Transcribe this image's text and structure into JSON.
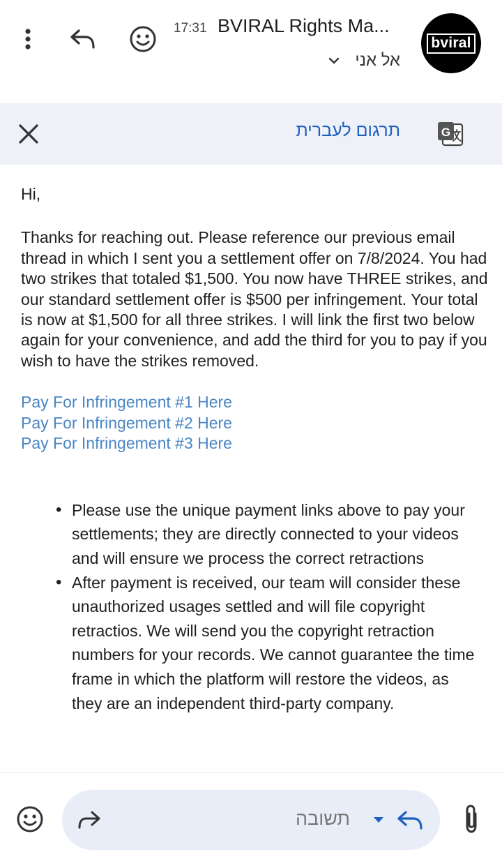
{
  "header": {
    "time": "17:31",
    "sender": "BVIRAL Rights Ma...",
    "recipient": "אל אני",
    "avatar_text": "bviral"
  },
  "translate_bar": {
    "label": "תרגום לעברית"
  },
  "email": {
    "greeting": "Hi,",
    "paragraph": "Thanks for reaching out. Please reference our previous email thread in which I sent you a settlement offer on 7/8/2024. You had two strikes that totaled $1,500. You now have THREE strikes, and our standard settlement offer is $500 per infringement. Your total is now at $1,500 for all three strikes. I will link the first two below again for your convenience, and add the third for you to pay if you wish to have the strikes removed.",
    "links": [
      "Pay For Infringement #1 Here",
      "Pay For Infringement #2 Here",
      "Pay For Infringement #3 Here"
    ],
    "bullets": [
      "Please use the unique payment links above to pay your settlements; they are directly connected to your videos and will ensure we process the correct retractions",
      "After payment is received, our team will consider these unauthorized usages settled and will file copyright retractios. We will send you the copyright retraction numbers for your records. We cannot guarantee the time frame in which the platform will restore the videos, as they are an independent third-party company."
    ]
  },
  "bottom_bar": {
    "reply_label": "תשובה"
  },
  "colors": {
    "link": "#4a86c4",
    "translate_link": "#1f5fbf",
    "translate_bg": "#eef1f8",
    "reply_pill_bg": "#e9edf8"
  },
  "icons": {
    "kebab": "more-vert-icon",
    "reply": "reply-icon",
    "emoji": "emoji-icon",
    "close": "close-icon",
    "translate": "google-translate-icon",
    "forward": "forward-icon",
    "attach": "attach-icon"
  }
}
